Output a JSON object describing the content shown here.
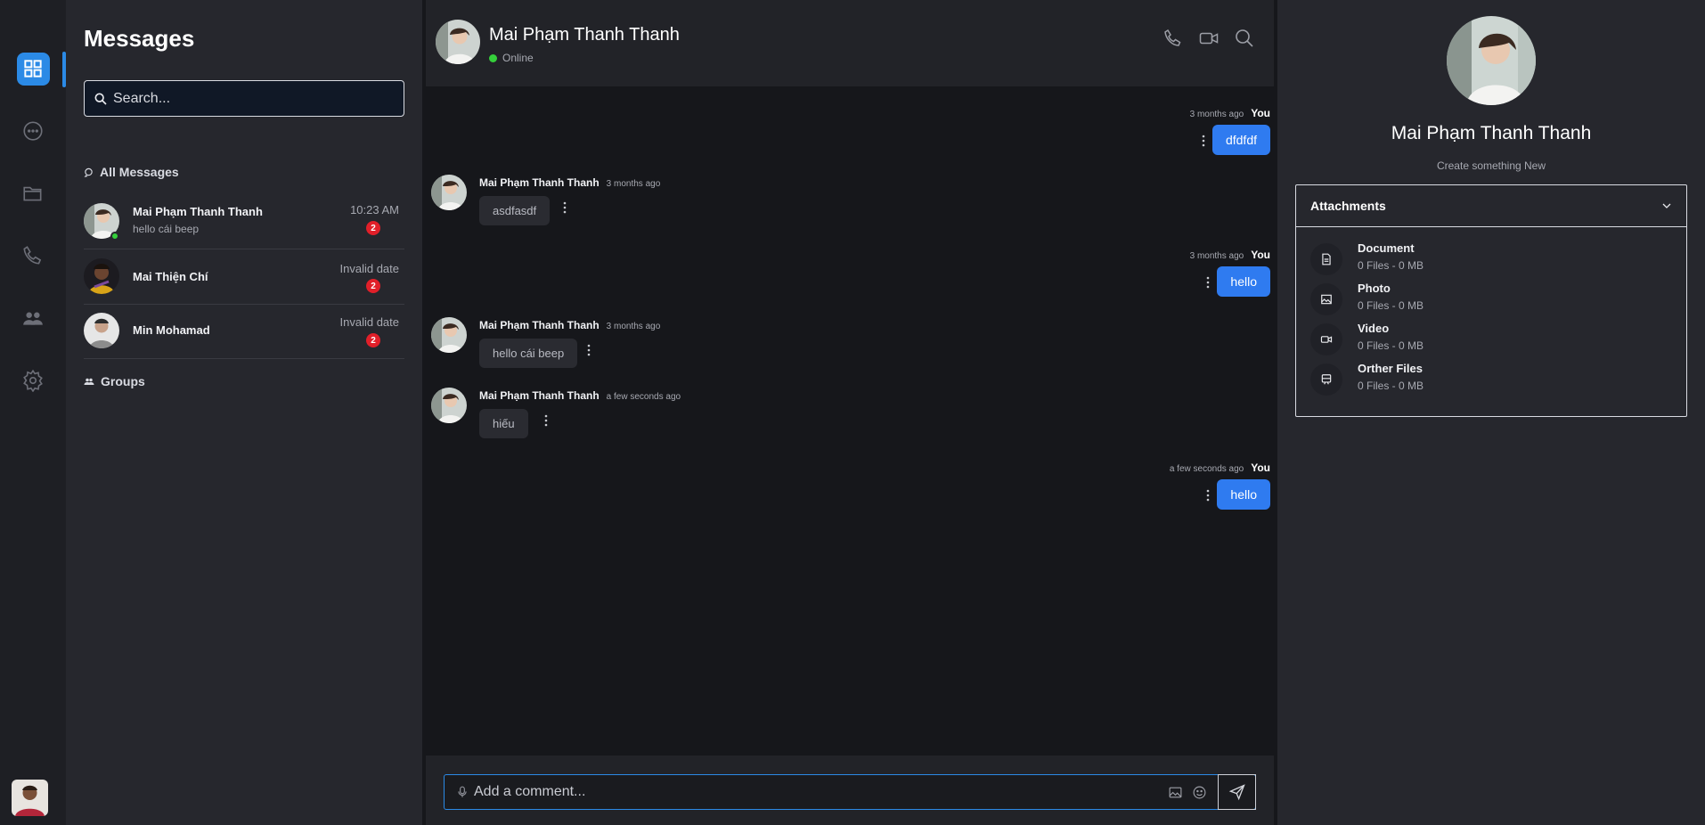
{
  "sidebar_list": {
    "title": "Messages",
    "search_placeholder": "Search...",
    "all_messages_label": "All Messages",
    "groups_label": "Groups",
    "conversations": [
      {
        "name": "Mai Phạm Thanh Thanh",
        "preview": "hello cái beep",
        "time": "10:23 AM",
        "unread": "2",
        "online": true
      },
      {
        "name": "Mai Thiện Chí",
        "preview": "",
        "time": "Invalid date",
        "unread": "2",
        "online": false
      },
      {
        "name": "Min Mohamad",
        "preview": "",
        "time": "Invalid date",
        "unread": "2",
        "online": false
      }
    ]
  },
  "chat": {
    "name": "Mai Phạm Thanh Thanh",
    "status": "Online",
    "composer_placeholder": "Add a comment...",
    "messages": [
      {
        "from": "You",
        "time": "3 months ago",
        "text": "dfdfdf"
      },
      {
        "from": "Mai Phạm Thanh Thanh",
        "time": "3 months ago",
        "text": "asdfasdf"
      },
      {
        "from": "You",
        "time": "3 months ago",
        "text": "hello"
      },
      {
        "from": "Mai Phạm Thanh Thanh",
        "time": "3 months ago",
        "text": "hello cái beep"
      },
      {
        "from": "Mai Phạm Thanh Thanh",
        "time": "a few seconds ago",
        "text": "hiếu"
      },
      {
        "from": "You",
        "time": "a few seconds ago",
        "text": "hello"
      }
    ]
  },
  "info": {
    "name": "Mai Phạm Thanh Thanh",
    "subtitle": "Create something New",
    "attachments_title": "Attachments",
    "attachments": [
      {
        "name": "Document",
        "size": "0 Files - 0 MB",
        "icon": "document-icon"
      },
      {
        "name": "Photo",
        "size": "0 Files - 0 MB",
        "icon": "photo-icon"
      },
      {
        "name": "Video",
        "size": "0 Files - 0 MB",
        "icon": "video-icon"
      },
      {
        "name": "Orther Files",
        "size": "0 Files - 0 MB",
        "icon": "files-icon"
      }
    ]
  },
  "colors": {
    "accent": "#2b8ae6",
    "bubble_out": "#2f7bf0",
    "online": "#35d03b",
    "badge": "#e11f29"
  }
}
